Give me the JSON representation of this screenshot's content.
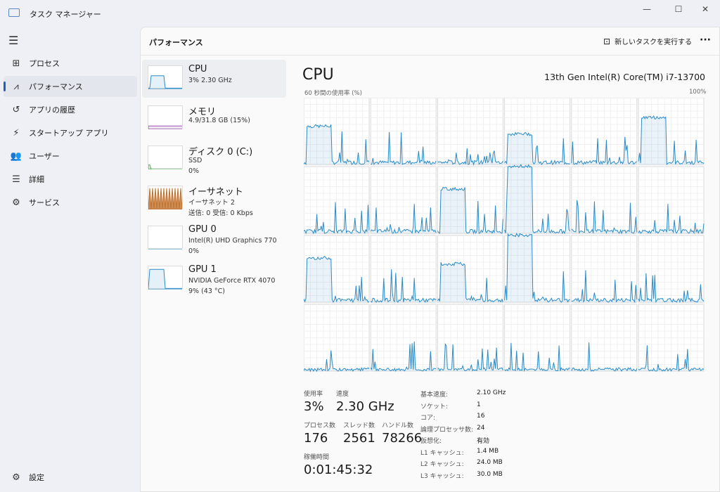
{
  "window": {
    "title": "タスク マネージャー",
    "minimize": "—",
    "maximize": "☐",
    "close": "✕"
  },
  "sidebar": {
    "items": [
      {
        "label": "プロセス",
        "icon": "processes-icon",
        "glyph": "⊞"
      },
      {
        "label": "パフォーマンス",
        "icon": "performance-icon",
        "glyph": "⩘",
        "active": true
      },
      {
        "label": "アプリの履歴",
        "icon": "history-icon",
        "glyph": "↺"
      },
      {
        "label": "スタートアップ アプリ",
        "icon": "startup-icon",
        "glyph": "⚡"
      },
      {
        "label": "ユーザー",
        "icon": "users-icon",
        "glyph": "👥"
      },
      {
        "label": "詳細",
        "icon": "details-icon",
        "glyph": "☰"
      },
      {
        "label": "サービス",
        "icon": "services-icon",
        "glyph": "⚙"
      }
    ],
    "settings": "設定"
  },
  "header": {
    "title": "パフォーマンス",
    "run_task": "新しいタスクを実行する",
    "more": "···"
  },
  "devices": [
    {
      "name": "CPU",
      "lines": [
        "3%  2.30 GHz"
      ],
      "color": "#2b8bc6"
    },
    {
      "name": "メモリ",
      "lines": [
        "4.9/31.8 GB (15%)"
      ],
      "color": "#9b4fb0"
    },
    {
      "name": "ディスク 0 (C:)",
      "lines": [
        "SSD",
        "0%"
      ],
      "color": "#4caf50"
    },
    {
      "name": "イーサネット",
      "lines": [
        "イーサネット 2",
        "送信: 0  受信: 0 Kbps"
      ],
      "color": "#c0712c"
    },
    {
      "name": "GPU 0",
      "lines": [
        "Intel(R) UHD Graphics 770",
        "0%"
      ],
      "color": "#2b8bc6"
    },
    {
      "name": "GPU 1",
      "lines": [
        "NVIDIA GeForce RTX 4070",
        "9%  (43 °C)"
      ],
      "color": "#2b8bc6"
    }
  ],
  "cpu": {
    "title": "CPU",
    "model": "13th Gen Intel(R) Core(TM) i7-13700",
    "graph_label": "60 秒間の使用率 (%)",
    "graph_max": "100%",
    "logical_processors": 24
  },
  "stats": {
    "usage_label": "使用率",
    "usage": "3%",
    "speed_label": "速度",
    "speed": "2.30 GHz",
    "proc_label": "プロセス数",
    "proc": "176",
    "thread_label": "スレッド数",
    "thread": "2561",
    "handle_label": "ハンドル数",
    "handle": "78266",
    "uptime_label": "稼働時間",
    "uptime": "0:01:45:32"
  },
  "specs": [
    {
      "k": "基本速度:",
      "v": "2.10 GHz"
    },
    {
      "k": "ソケット:",
      "v": "1"
    },
    {
      "k": "コア:",
      "v": "16"
    },
    {
      "k": "論理プロセッサ数:",
      "v": "24"
    },
    {
      "k": "仮想化:",
      "v": "有効"
    },
    {
      "k": "L1 キャッシュ:",
      "v": "1.4 MB"
    },
    {
      "k": "L2 キャッシュ:",
      "v": "24.0 MB"
    },
    {
      "k": "L3 キャッシュ:",
      "v": "30.0 MB"
    }
  ]
}
